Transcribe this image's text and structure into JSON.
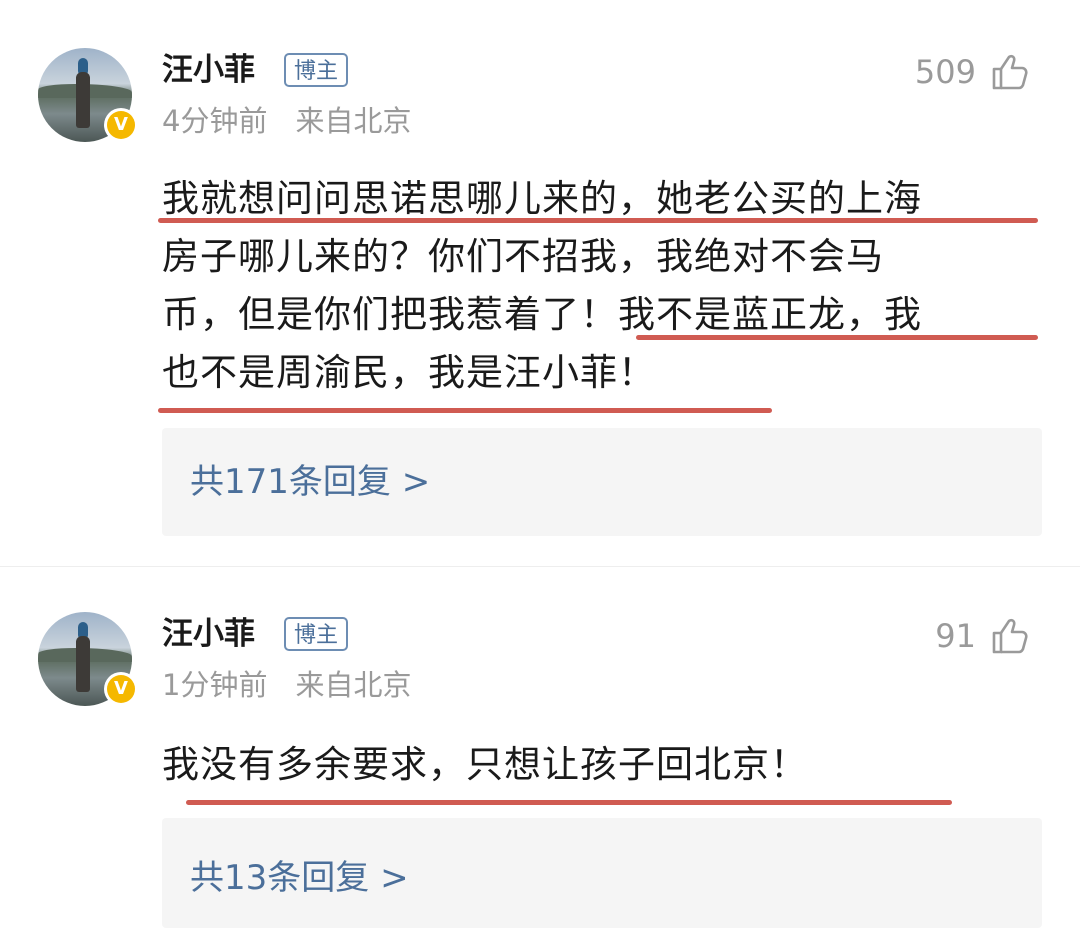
{
  "comments": [
    {
      "username": "汪小菲",
      "tag": "博主",
      "time": "4分钟前",
      "location": "来自北京",
      "likes": "509",
      "lines": [
        "我就想问问思诺思哪儿来的，她老公买的上海",
        "房子哪儿来的？你们不招我，我绝对不会马",
        "币，但是你们把我惹着了！我不是蓝正龙，我",
        "也不是周渝民，我是汪小菲！"
      ],
      "replies_label": "共171条回复 >"
    },
    {
      "username": "汪小菲",
      "tag": "博主",
      "time": "1分钟前",
      "location": "来自北京",
      "likes": "91",
      "lines": [
        "我没有多余要求，只想让孩子回北京！"
      ],
      "replies_label": "共13条回复 >"
    }
  ],
  "icons": {
    "like": "thumbs-up-icon",
    "verified": "verified-v-icon"
  },
  "colors": {
    "highlight": "#c9443a",
    "link": "#4b6f9a",
    "verified": "#f5b800",
    "meta": "#9a9a9a"
  }
}
